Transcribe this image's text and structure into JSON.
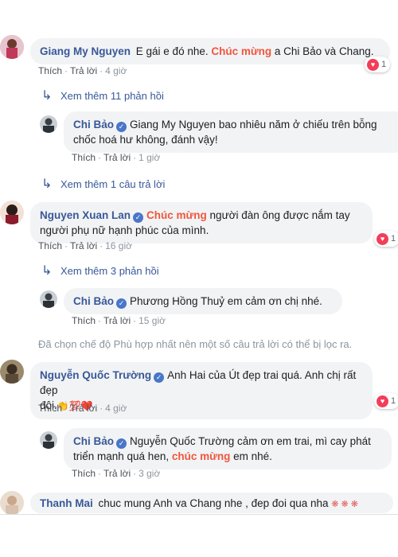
{
  "comments": [
    {
      "name": "Giang My Nguyen",
      "text_parts": [
        "E gái e đó nhe. ",
        "Chúc mừng",
        " a Chi Bảo và Chang."
      ],
      "like": "Thích",
      "reply": "Trả lời",
      "time": "4 giờ",
      "reaction_count": "1"
    },
    {
      "more_replies": "Xem thêm 11 phản hồi"
    },
    {
      "name": "Chi Bảo",
      "text_line1": "Giang My Nguyen bao nhiêu năm ở chiếu trên bỗng",
      "text_line2": "chốc hoá hư không, đánh vậy!",
      "like": "Thích",
      "reply": "Trả lời",
      "time": "1 giờ"
    },
    {
      "more_replies": "Xem thêm 1 câu trả lời"
    },
    {
      "name": "Nguyen Xuan Lan",
      "kw": "Chúc mừng",
      "text_line1": " người đàn ông được nắm tay",
      "text_line2": "người phụ nữ hạnh phúc của mình.",
      "like": "Thích",
      "reply": "Trả lời",
      "time": "16 giờ",
      "reaction_count": "1"
    },
    {
      "more_replies": "Xem thêm 3 phản hồi"
    },
    {
      "name": "Chi Bảo",
      "text": "Phương Hồng Thuỷ em cảm ơn chị nhé.",
      "like": "Thích",
      "reply": "Trả lời",
      "time": "15 giờ"
    },
    {
      "filter_note": "Đã chọn chế độ Phù hợp nhất nên một số câu trả lời có thể bị lọc ra."
    },
    {
      "name": "Nguyễn Quốc Trường",
      "text_line1": "Anh Hai của Út đẹp trai quá. Anh chị rất đẹp",
      "text_line2": "đôi.",
      "emoji": "👏💯❤️",
      "like": "Thích",
      "reply": "Trả lời",
      "time": "4 giờ",
      "reaction_count": "1"
    },
    {
      "name": "Chi Bảo",
      "text_line1": "Nguyễn Quốc Trường cảm ơn em trai, mì cay phát",
      "text_line2_a": "triển mạnh quá hen, ",
      "kw": "chúc mừng",
      "text_line2_b": " em nhé.",
      "like": "Thích",
      "reply": "Trả lời",
      "time": "3 giờ"
    },
    {
      "name": "Thanh Mai",
      "text": "chuc mung Anh va Chang nhe , đep đoi qua nha",
      "emoji": "❋ ❋ ❋"
    }
  ],
  "colors": {
    "name": "#385898",
    "keyword": "#f0563d",
    "bubble": "#f2f3f5",
    "heart": "#f33e58",
    "verified": "#4a76c7"
  }
}
